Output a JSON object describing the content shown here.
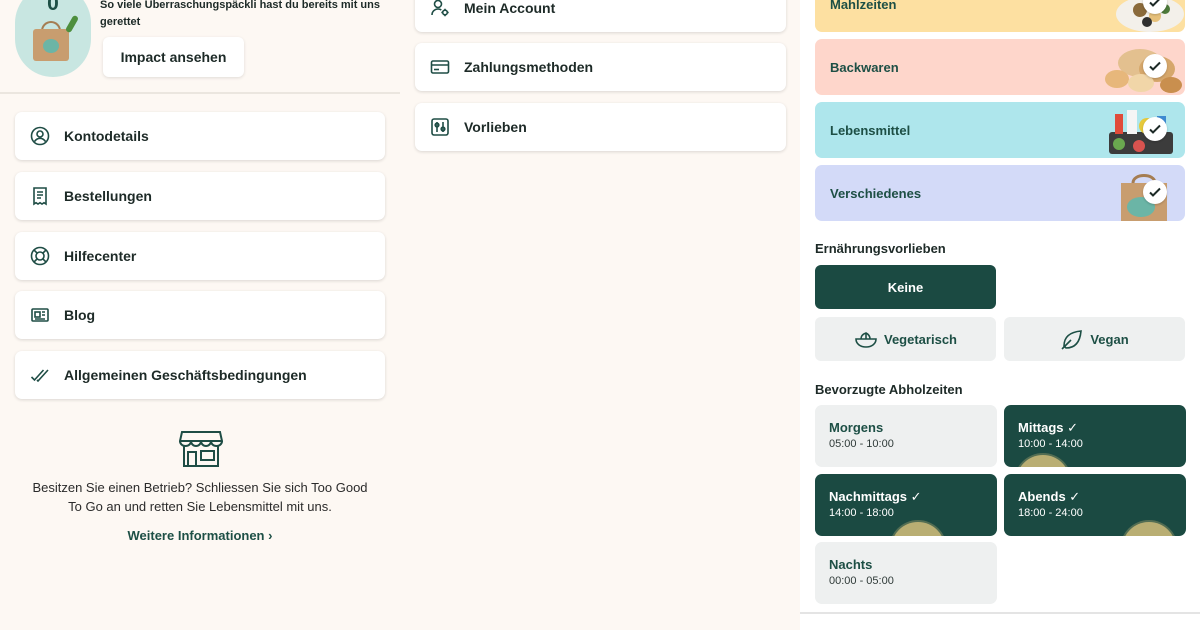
{
  "profile": {
    "saved_count": "0",
    "impact_text": "So viele Überraschungspäckli hast du bereits mit uns gerettet",
    "impact_button": "Impact ansehen"
  },
  "menu": [
    {
      "label": "Kontodetails",
      "icon": "user-circle-icon"
    },
    {
      "label": "Bestellungen",
      "icon": "receipt-icon"
    },
    {
      "label": "Hilfecenter",
      "icon": "lifebuoy-icon"
    },
    {
      "label": "Blog",
      "icon": "newspaper-icon"
    },
    {
      "label": "Allgemeinen Geschäftsbedingungen",
      "icon": "double-check-icon"
    }
  ],
  "business": {
    "text": "Besitzen Sie einen Betrieb? Schliessen Sie sich Too Good To Go an und retten Sie Lebensmittel mit uns.",
    "link": "Weitere Informationen",
    "icon": "store-icon"
  },
  "settings": [
    {
      "label": "Mein Account",
      "icon": "account-settings-icon"
    },
    {
      "label": "Zahlungsmethoden",
      "icon": "credit-card-icon"
    },
    {
      "label": "Vorlieben",
      "icon": "sliders-icon"
    }
  ],
  "categories": [
    {
      "label": "Mahlzeiten",
      "color": "#fde0a1",
      "selected": true
    },
    {
      "label": "Backwaren",
      "color": "#fed6cb",
      "selected": true
    },
    {
      "label": "Lebensmittel",
      "color": "#aee6ec",
      "selected": true
    },
    {
      "label": "Verschiedenes",
      "color": "#d3daf8",
      "selected": true
    }
  ],
  "diet": {
    "title": "Ernährungsvorlieben",
    "options": [
      {
        "label": "Keine",
        "selected": true
      },
      {
        "label": "Vegetarisch",
        "selected": false,
        "icon": "salad-bowl-icon"
      },
      {
        "label": "Vegan",
        "selected": false,
        "icon": "leaf-icon"
      }
    ]
  },
  "pickup": {
    "title": "Bevorzugte Abholzeiten",
    "slots": [
      {
        "name": "Morgens",
        "time": "05:00 - 10:00",
        "selected": false
      },
      {
        "name": "Mittags ✓",
        "time": "10:00 - 14:00",
        "selected": true
      },
      {
        "name": "Nachmittags ✓",
        "time": "14:00 - 18:00",
        "selected": true
      },
      {
        "name": "Abends ✓",
        "time": "18:00 - 24:00",
        "selected": true
      },
      {
        "name": "Nachts",
        "time": "00:00 - 05:00",
        "selected": false
      }
    ]
  },
  "colors": {
    "brand_dark": "#1b4a42",
    "background": "#fdf8f3"
  }
}
